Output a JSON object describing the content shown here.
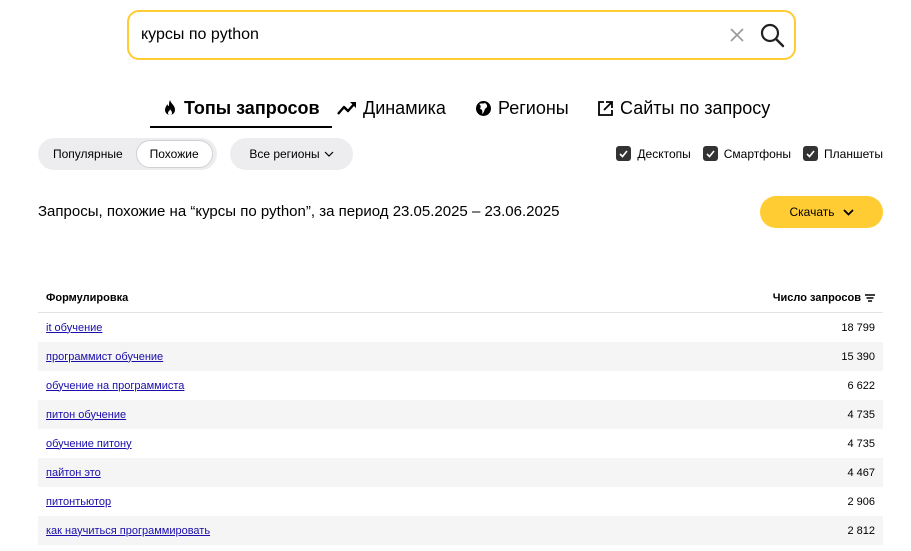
{
  "search": {
    "value": "курсы по python"
  },
  "tabs": [
    {
      "label": "Топы запросов",
      "icon": "fire-icon"
    },
    {
      "label": "Динамика",
      "icon": "trend-icon"
    },
    {
      "label": "Регионы",
      "icon": "globe-icon"
    },
    {
      "label": "Сайты по запросу",
      "icon": "external-link-icon"
    }
  ],
  "filters": {
    "mode_popular": "Популярные",
    "mode_similar": "Похожие",
    "region": "Все регионы",
    "devices": [
      "Десктопы",
      "Смартфоны",
      "Планшеты"
    ]
  },
  "heading": "Запросы, похожие на “курсы по python”, за период 23.05.2025 – 23.06.2025",
  "download_label": "Скачать",
  "table": {
    "col_phrase": "Формулировка",
    "col_count": "Число запросов",
    "rows": [
      {
        "phrase": "it обучение",
        "count": "18 799"
      },
      {
        "phrase": "программист обучение",
        "count": "15 390"
      },
      {
        "phrase": "обучение на программиста",
        "count": "6 622"
      },
      {
        "phrase": "питон обучение",
        "count": "4 735"
      },
      {
        "phrase": "обучение питону",
        "count": "4 735"
      },
      {
        "phrase": "пайтон это",
        "count": "4 467"
      },
      {
        "phrase": "питонтьютор",
        "count": "2 906"
      },
      {
        "phrase": "как научиться программировать",
        "count": "2 812"
      }
    ]
  },
  "colors": {
    "accent": "#ffcc33",
    "link": "#1a0dab"
  }
}
